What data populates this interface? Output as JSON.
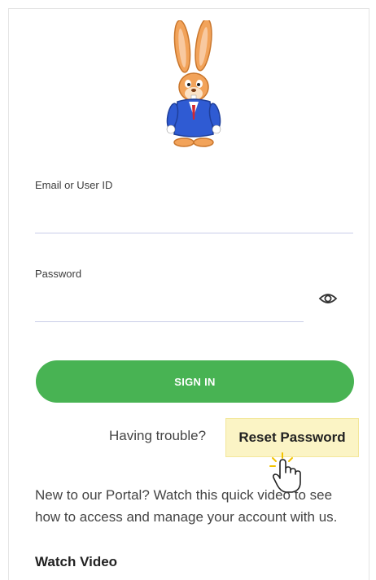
{
  "login": {
    "email_label": "Email or User ID",
    "email_value": "",
    "password_label": "Password",
    "password_value": "",
    "sign_in_label": "SIGN IN",
    "trouble_text": "Having trouble?",
    "reset_label": "Reset Password",
    "new_portal_text": "New to our Portal? Watch this quick video to see how to access and manage your account with us.",
    "watch_video_label": "Watch Video"
  },
  "icons": {
    "logo": "rabbit-mascot-logo",
    "eye": "eye-icon",
    "pointer": "pointing-hand-cursor-icon"
  },
  "colors": {
    "primary_green": "#48b353",
    "highlight_yellow": "#fbf4c5",
    "field_underline": "#c9cde8"
  }
}
